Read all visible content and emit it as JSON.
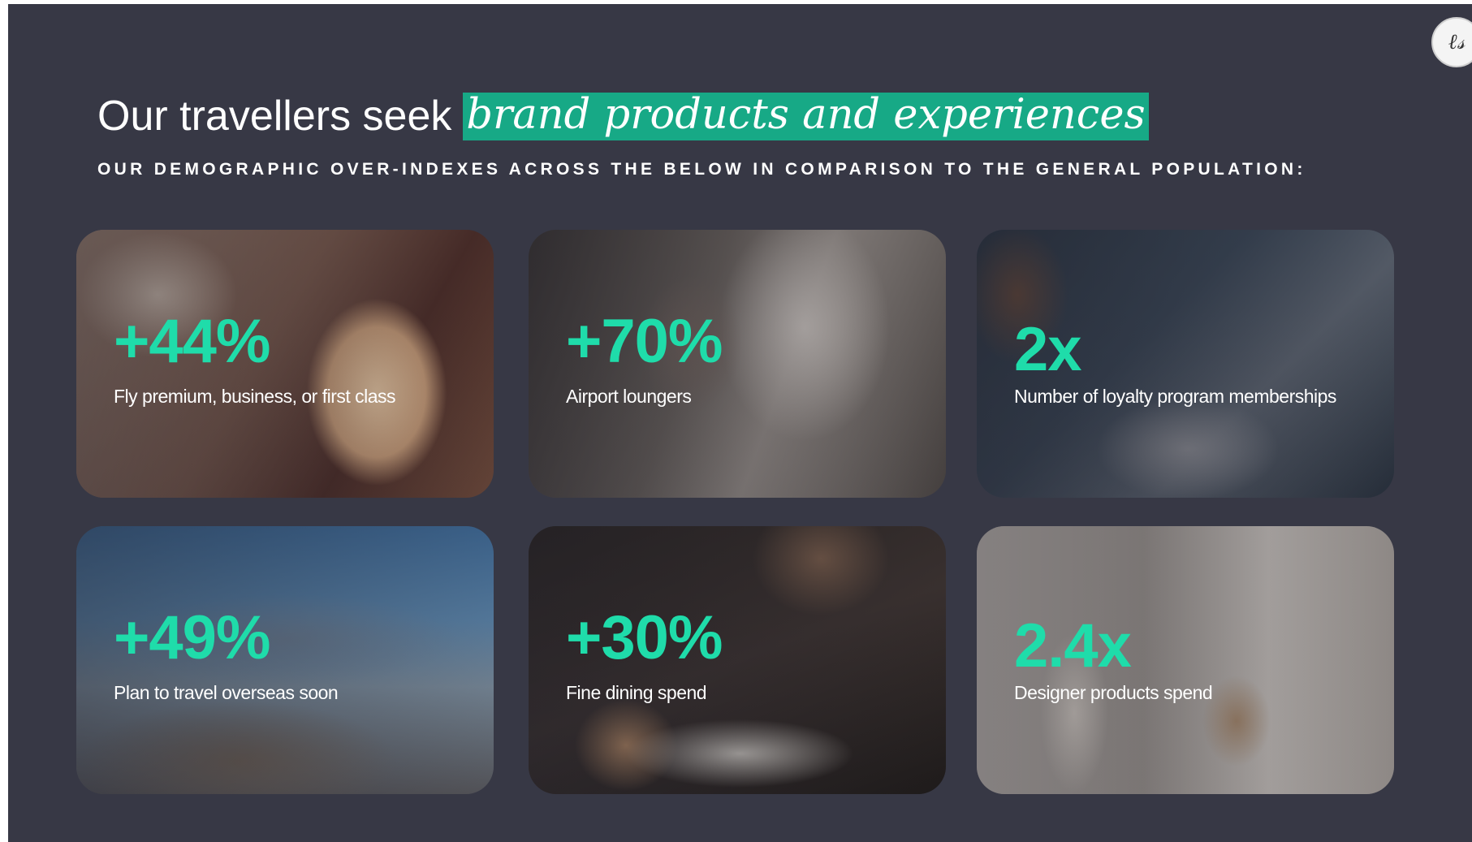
{
  "logo": {
    "text": "𝓁𝓂"
  },
  "header": {
    "title_plain": "Our travellers seek",
    "title_highlight": "brand products and experiences",
    "subtitle": "OUR DEMOGRAPHIC OVER-INDEXES ACROSS THE BELOW IN COMPARISON TO THE GENERAL POPULATION:"
  },
  "colors": {
    "accent": "#1fdcaa",
    "highlight_bg": "#17a986",
    "background": "#373845"
  },
  "cards": [
    {
      "stat": "+44%",
      "label": "Fly premium, business, or first class"
    },
    {
      "stat": "+70%",
      "label": "Airport loungers"
    },
    {
      "stat": "2x",
      "label": "Number of loyalty program memberships"
    },
    {
      "stat": "+49%",
      "label": "Plan to travel overseas soon"
    },
    {
      "stat": "+30%",
      "label": "Fine dining spend"
    },
    {
      "stat": "2.4x",
      "label": "Designer products spend"
    }
  ]
}
